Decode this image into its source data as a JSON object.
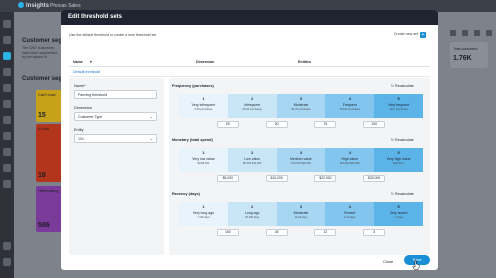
{
  "app": {
    "brand": "Insights",
    "crumb": "Phocas Sales",
    "bg_title_1": "Customer segm",
    "bg_title_2": "Customer segme",
    "bg_text": "The 1267 customers have been segmented by the values of...",
    "total_label": "Total customers",
    "total_value": "1.76K",
    "cards": [
      {
        "label": "Can't lose",
        "value": "15"
      },
      {
        "label": "At risk",
        "value": "18"
      },
      {
        "label": "Hibernating",
        "value": "586"
      }
    ]
  },
  "modal": {
    "title": "Edit threshold sets",
    "description": "Use the default threshold or create a new threshold set",
    "create_label": "Create new set",
    "create_icon": "plus-icon",
    "table": {
      "headers": [
        "Name",
        "Dimension",
        "Entities"
      ],
      "rows": [
        {
          "name": "Default threshold"
        }
      ]
    },
    "form": {
      "name_label": "Name*",
      "name_value": "Farming threshold",
      "dimension_label": "Dimension",
      "dimension_value": "Customer Type",
      "entity_label": "Entity",
      "entity_value": "101"
    },
    "sections": [
      {
        "title": "Frequency (purchases)",
        "recalc": "Recalculate",
        "bands": [
          {
            "n": "1",
            "title": "Very infrequent",
            "range": "0-25 purchases"
          },
          {
            "n": "2",
            "title": "Infrequent",
            "range": "25-50 purchases"
          },
          {
            "n": "3",
            "title": "Moderate",
            "range": "50-75 purchases"
          },
          {
            "n": "4",
            "title": "Frequent",
            "range": "75-100 purchases"
          },
          {
            "n": "5",
            "title": "Very frequent",
            "range": "100+ purchases"
          }
        ],
        "thresholds": [
          "25",
          "50",
          "75",
          "100"
        ]
      },
      {
        "title": "Monetary (total spend)",
        "recalc": "Recalculate",
        "bands": [
          {
            "n": "1",
            "title": "Very low value",
            "range": "$0-$5,000"
          },
          {
            "n": "2",
            "title": "Low value",
            "range": "$5,000-$10,000"
          },
          {
            "n": "3",
            "title": "Medium value",
            "range": "$10,000-$20,000"
          },
          {
            "n": "4",
            "title": "High value",
            "range": "$20,000-$30,000"
          },
          {
            "n": "5",
            "title": "Very high value",
            "range": "$30,000+"
          }
        ],
        "thresholds": [
          "$5,000",
          "$10,000",
          "$20,000",
          "$30,000"
        ]
      },
      {
        "title": "Recency (days)",
        "recalc": "Recalculate",
        "bands": [
          {
            "n": "1",
            "title": "Very long ago",
            "range": "> 160 days"
          },
          {
            "n": "2",
            "title": "Long ago",
            "range": "45-160 days"
          },
          {
            "n": "3",
            "title": "Moderate",
            "range": "12-45 days"
          },
          {
            "n": "4",
            "title": "Recent",
            "range": "3-12 days"
          },
          {
            "n": "5",
            "title": "Very recent",
            "range": "< 3 days"
          }
        ],
        "thresholds": [
          "160",
          "45",
          "12",
          "3"
        ]
      }
    ],
    "band_colors": [
      "#e8f4fb",
      "#c9e6f7",
      "#a7d6f3",
      "#82c5ee",
      "#5cb3e8"
    ],
    "close_label": "Close",
    "save_label": "Save"
  }
}
